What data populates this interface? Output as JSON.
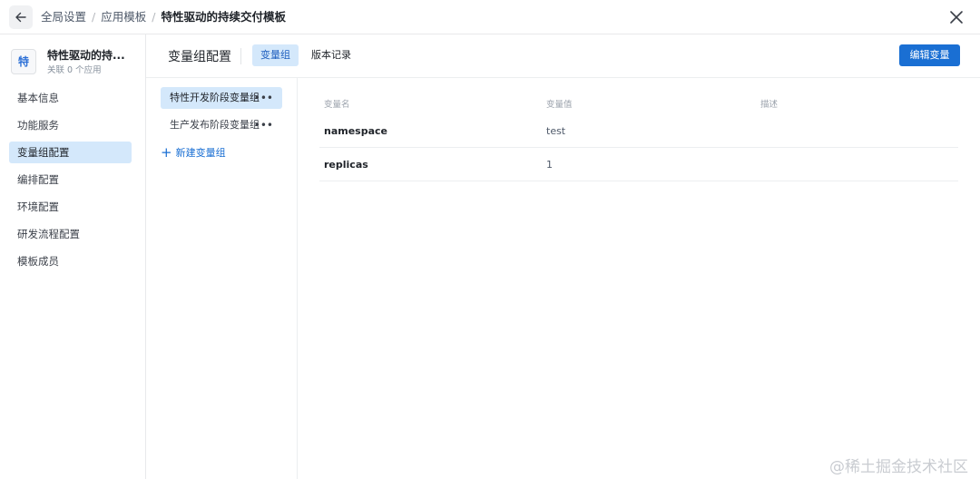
{
  "breadcrumb": {
    "items": [
      "全局设置",
      "应用模板"
    ],
    "separator": "/",
    "current": "特性驱动的持续交付模板"
  },
  "template": {
    "avatar_char": "特",
    "name": "特性驱动的持...",
    "sub": "关联 0 个应用"
  },
  "sidebar": {
    "items": [
      {
        "label": "基本信息"
      },
      {
        "label": "功能服务"
      },
      {
        "label": "变量组配置",
        "active": true
      },
      {
        "label": "编排配置"
      },
      {
        "label": "环境配置"
      },
      {
        "label": "研发流程配置"
      },
      {
        "label": "模板成员"
      }
    ]
  },
  "header": {
    "title": "变量组配置",
    "tabs": [
      {
        "label": "变量组",
        "active": true
      },
      {
        "label": "版本记录"
      }
    ],
    "edit_button": "编辑变量"
  },
  "groups": {
    "items": [
      {
        "label": "特性开发阶段变量组",
        "more": "•••",
        "active": true
      },
      {
        "label": "生产发布阶段变量组",
        "more": "•••"
      }
    ],
    "new_label": "新建变量组"
  },
  "table": {
    "columns": [
      "变量名",
      "变量值",
      "描述"
    ],
    "rows": [
      {
        "name": "namespace",
        "value": "test",
        "desc": ""
      },
      {
        "name": "replicas",
        "value": "1",
        "desc": ""
      }
    ]
  },
  "watermark": "@稀土掘金技术社区",
  "colors": {
    "accent": "#1a6fd3",
    "active_bg": "#d4e8fb"
  }
}
